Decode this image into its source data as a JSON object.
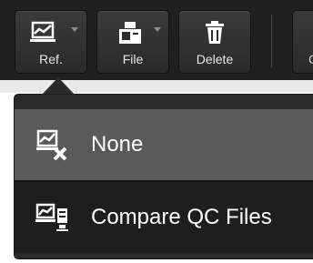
{
  "toolbar": {
    "ref_label": "Ref.",
    "file_label": "File",
    "delete_label": "Delete",
    "partial_label": "C"
  },
  "menu": {
    "items": [
      {
        "label": "None",
        "icon": "chart-remove-icon",
        "selected": true
      },
      {
        "label": "Compare QC Files",
        "icon": "chart-compare-files-icon",
        "selected": false
      }
    ]
  },
  "colors": {
    "toolbar_bg": "#202020",
    "menu_bg": "#2a2a2a",
    "selected_item_bg": "#5a5a5a"
  }
}
